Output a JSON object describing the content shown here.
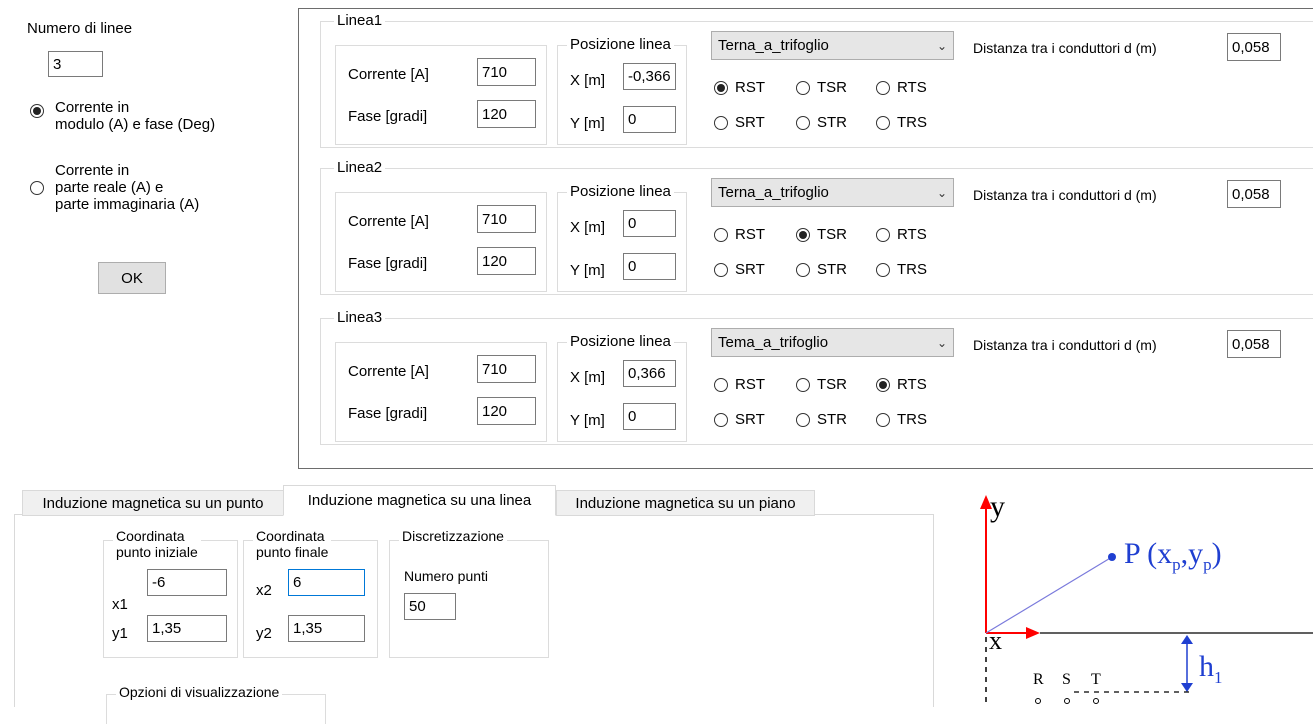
{
  "left": {
    "num_lines_label": "Numero di linee",
    "num_lines_value": "3",
    "option_polar": [
      "Corrente in",
      "modulo (A) e fase (Deg)"
    ],
    "option_cartesian": [
      "Corrente in",
      "parte reale (A) e",
      "parte immaginaria (A)"
    ],
    "ok_label": "OK"
  },
  "lines": [
    {
      "title": "Linea1",
      "current_label": "Corrente [A]",
      "current_value": "710",
      "phase_label": "Fase [gradi]",
      "phase_value": "120",
      "position_title": "Posizione linea",
      "x_label": "X [m]",
      "x_value": "-0,366",
      "y_label": "Y [m]",
      "y_value": "0",
      "config": "Terna_a_trifoglio",
      "distance_label": "Distanza tra i conduttori d (m)",
      "distance_value": "0,058",
      "phase_orders": [
        "RST",
        "TSR",
        "RTS",
        "SRT",
        "STR",
        "TRS"
      ],
      "selected_order": "RST"
    },
    {
      "title": "Linea2",
      "current_label": "Corrente [A]",
      "current_value": "710",
      "phase_label": "Fase [gradi]",
      "phase_value": "120",
      "position_title": "Posizione linea",
      "x_label": "X [m]",
      "x_value": "0",
      "y_label": "Y [m]",
      "y_value": "0",
      "config": "Terna_a_trifoglio",
      "distance_label": "Distanza tra i conduttori d (m)",
      "distance_value": "0,058",
      "phase_orders": [
        "RST",
        "TSR",
        "RTS",
        "SRT",
        "STR",
        "TRS"
      ],
      "selected_order": "TSR"
    },
    {
      "title": "Linea3",
      "current_label": "Corrente [A]",
      "current_value": "710",
      "phase_label": "Fase [gradi]",
      "phase_value": "120",
      "position_title": "Posizione linea",
      "x_label": "X [m]",
      "x_value": "0,366",
      "y_label": "Y [m]",
      "y_value": "0",
      "config": "Tema_a_trifoglio",
      "distance_label": "Distanza tra i conduttori d (m)",
      "distance_value": "0,058",
      "phase_orders": [
        "RST",
        "TSR",
        "RTS",
        "SRT",
        "STR",
        "TRS"
      ],
      "selected_order": "RTS"
    }
  ],
  "tabs": [
    "Induzione magnetica su un punto",
    "Induzione magnetica su una linea",
    "Induzione magnetica su un piano"
  ],
  "active_tab": "Induzione magnetica su una linea",
  "line_tab": {
    "start_title": [
      "Coordinata",
      "punto iniziale"
    ],
    "x1_label": "x1",
    "x1_value": "-6",
    "y1_label": "y1",
    "y1_value": "1,35",
    "end_title": [
      "Coordinata",
      "punto finale"
    ],
    "x2_label": "x2",
    "x2_value": "6",
    "y2_label": "y2",
    "y2_value": "1,35",
    "disc_title": "Discretizzazione",
    "num_points_label": "Numero punti",
    "num_points_value": "50",
    "view_options_title": "Opzioni di visualizzazione"
  },
  "diagram": {
    "y_axis": "y",
    "x_axis": "x",
    "point_p": "P",
    "point_coords_open": "(x",
    "point_sub1": "p",
    "point_comma": ",y",
    "point_sub2": "p",
    "point_close": ")",
    "h_label": "h",
    "h_sub": "1",
    "conductors": [
      "R",
      "S",
      "T"
    ],
    "axis_color": "#ff0000",
    "arrow_color": "#1f3fd1"
  }
}
